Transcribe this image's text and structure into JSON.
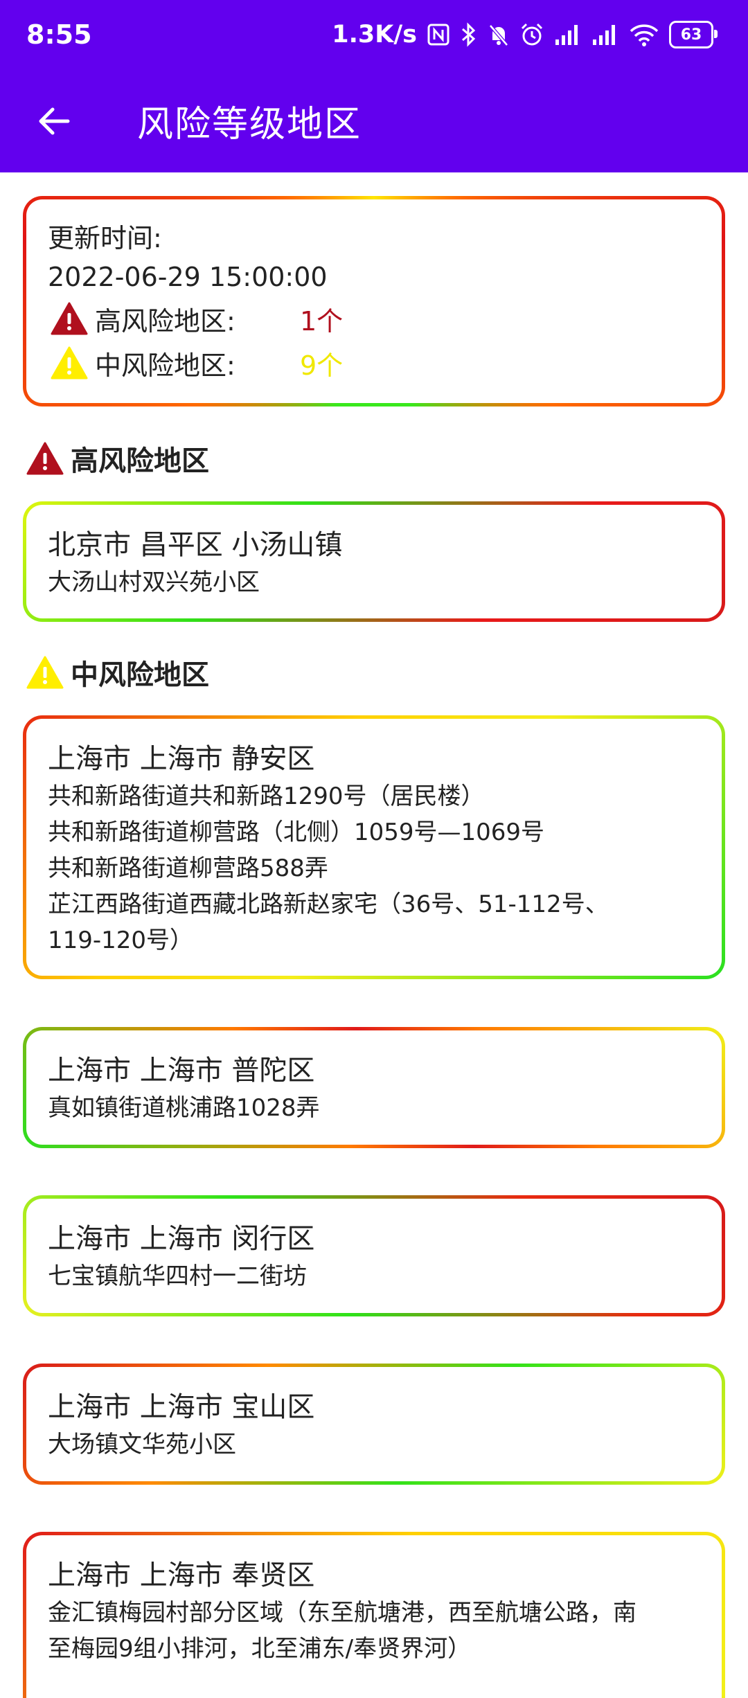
{
  "status_bar": {
    "time": "8:55",
    "net_speed": "1.3K/s",
    "battery": "63"
  },
  "app_bar": {
    "title": "风险等级地区",
    "back_icon": "arrow-back-icon"
  },
  "colors": {
    "primary": "#6200ee",
    "high_risk": "#b0101e",
    "mid_risk": "#ffee00",
    "text": "#222222"
  },
  "summary": {
    "update_label": "更新时间:",
    "update_time": "2022-06-29 15:00:00",
    "high_label": "高风险地区:",
    "high_count": "1个",
    "mid_label": "中风险地区:",
    "mid_count": "9个"
  },
  "high_section": {
    "heading": "高风险地区",
    "items": [
      {
        "title": "北京市 昌平区 小汤山镇",
        "lines": [
          "大汤山村双兴苑小区"
        ]
      }
    ]
  },
  "mid_section": {
    "heading": "中风险地区",
    "items": [
      {
        "title": "上海市 上海市 静安区",
        "lines": [
          "共和新路街道共和新路1290号（居民楼）",
          "共和新路街道柳营路（北侧）1059号—1069号",
          "共和新路街道柳营路588弄",
          "芷江西路街道西藏北路新赵家宅（36号、51-112号、",
          "119-120号）"
        ]
      },
      {
        "title": "上海市 上海市 普陀区",
        "lines": [
          "真如镇街道桃浦路1028弄"
        ]
      },
      {
        "title": "上海市 上海市 闵行区",
        "lines": [
          "七宝镇航华四村一二街坊"
        ]
      },
      {
        "title": "上海市 上海市 宝山区",
        "lines": [
          "大场镇文华苑小区"
        ]
      },
      {
        "title": "上海市 上海市 奉贤区",
        "lines": [
          "金汇镇梅园村部分区域（东至航塘港，西至航塘公路，南",
          "至梅园9组小排河，北至浦东/奉贤界河）"
        ]
      }
    ]
  }
}
